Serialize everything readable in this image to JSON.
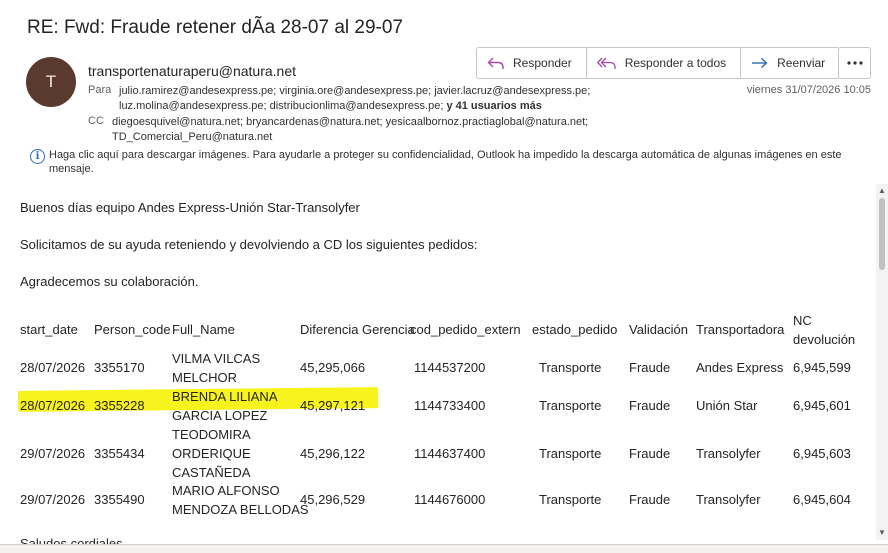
{
  "email": {
    "subject": "RE: Fwd: Fraude retener dÃa 28-07 al 29-07",
    "avatar_initial": "T",
    "sender": "transportenaturaperu@natura.net",
    "date": "viernes 31/07/2026 10:05",
    "to_label": "Para",
    "to_line1": "julio.ramirez@andesexpress.pe; virginia.ore@andesexpress.pe; javier.lacruz@andesexpress.pe;",
    "to_line2": "luz.molina@andesexpress.pe; distribucionlima@andesexpress.pe;",
    "to_more": "y 41 usuarios más",
    "cc_label": "CC",
    "cc_line1": "diegoesquivel@natura.net; bryancardenas@natura.net; yesicaalbornoz.practiaglobal@natura.net;",
    "cc_line2": "TD_Comercial_Peru@natura.net",
    "info_message": "Haga clic aquí para descargar imágenes. Para ayudarle a proteger su confidencialidad, Outlook ha impedido la descarga automática de algunas imágenes en este mensaje."
  },
  "actions": {
    "reply": "Responder",
    "reply_all": "Responder a todos",
    "forward": "Reenviar"
  },
  "body": {
    "greeting": "Buenos días equipo Andes Express-Unión Star-Transolyfer",
    "request": "Solicitamos de su ayuda reteniendo y devolviendo a CD los siguientes pedidos:",
    "thanks": "Agradecemos su colaboración.",
    "cut_off": "Saludos cordiales"
  },
  "table": {
    "headers": {
      "start_date": "start_date",
      "person_code": "Person_code",
      "full_name": "Full_Name",
      "diferencia": "Diferencia",
      "gerencia": "Gerencia",
      "cod_pedido": "cod_pedido_extern",
      "estado": "estado_pedido",
      "validacion": "Validación",
      "transportadora": "Transportadora",
      "nc1": "NC",
      "nc2": "devolución"
    },
    "rows": [
      {
        "start_date": "28/07/2026",
        "person_code": "3355170",
        "name1": "VILMA VILCAS",
        "name2": "MELCHOR",
        "name3": "",
        "diferencia": "45,295,066",
        "cod_pedido": "1144537200",
        "estado": "Transporte",
        "validacion": "Fraude",
        "transportadora": "Andes Express",
        "nc": "6,945,599"
      },
      {
        "start_date": "28/07/2026",
        "person_code": "3355228",
        "name1": "BRENDA LILIANA",
        "name2": "GARCIA LOPEZ",
        "name3": "",
        "diferencia": "45,297,121",
        "cod_pedido": "1144733400",
        "estado": "Transporte",
        "validacion": "Fraude",
        "transportadora": "Unión Star",
        "nc": "6,945,601"
      },
      {
        "start_date": "29/07/2026",
        "person_code": "3355434",
        "name1": "TEODOMIRA",
        "name2": "ORDERIQUE",
        "name3": "CASTAÑEDA",
        "diferencia": "45,296,122",
        "cod_pedido": "1144637400",
        "estado": "Transporte",
        "validacion": "Fraude",
        "transportadora": "Transolyfer",
        "nc": "6,945,603"
      },
      {
        "start_date": "29/07/2026",
        "person_code": "3355490",
        "name1": "MARIO ALFONSO",
        "name2": "MENDOZA BELLODAS",
        "name3": "",
        "diferencia": "45,296,529",
        "cod_pedido": "1144676000",
        "estado": "Transporte",
        "validacion": "Fraude",
        "transportadora": "Transolyfer",
        "nc": "6,945,604"
      }
    ]
  }
}
